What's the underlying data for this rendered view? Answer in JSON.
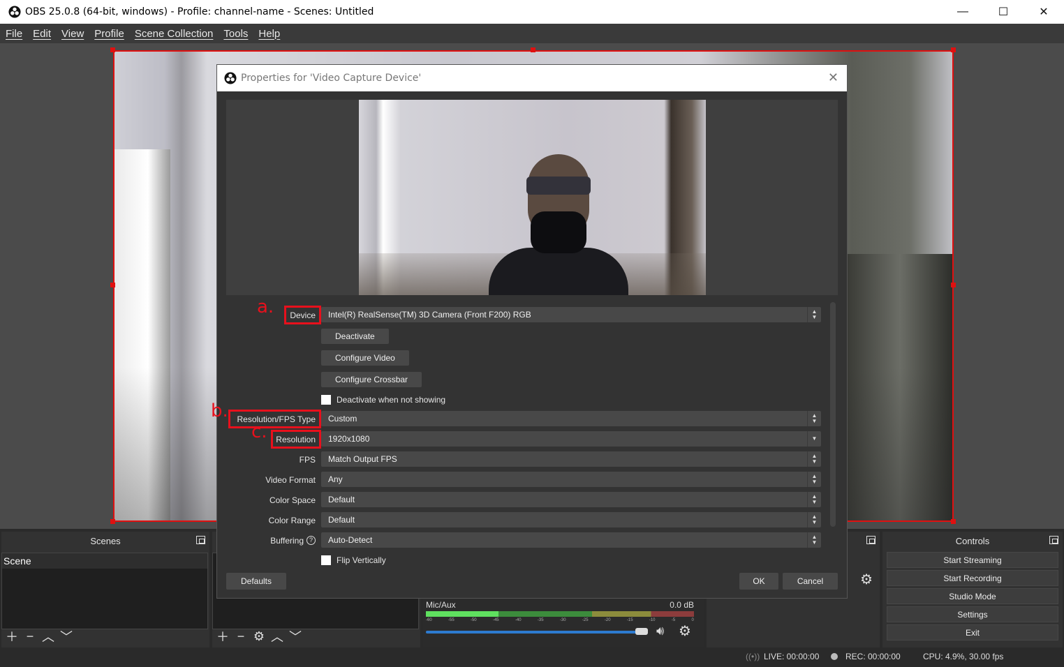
{
  "window": {
    "title": "OBS 25.0.8 (64-bit, windows) - Profile: channel-name - Scenes: Untitled",
    "minimize": "—",
    "maximize": "☐",
    "close": "✕"
  },
  "menu": [
    "File",
    "Edit",
    "View",
    "Profile",
    "Scene Collection",
    "Tools",
    "Help"
  ],
  "dialog": {
    "title": "Properties for 'Video Capture Device'",
    "close": "✕",
    "annotations": {
      "a": "a.",
      "b": "b.",
      "c": "c."
    },
    "fields": {
      "device": {
        "label": "Device",
        "value": "Intel(R) RealSense(TM) 3D Camera (Front F200) RGB"
      },
      "deactivate": "Deactivate",
      "configure_video": "Configure Video",
      "configure_crossbar": "Configure Crossbar",
      "deactivate_when_not_showing": "Deactivate when not showing",
      "res_fps_type": {
        "label": "Resolution/FPS Type",
        "value": "Custom"
      },
      "resolution": {
        "label": "Resolution",
        "value": "1920x1080"
      },
      "fps": {
        "label": "FPS",
        "value": "Match Output FPS"
      },
      "video_format": {
        "label": "Video Format",
        "value": "Any"
      },
      "color_space": {
        "label": "Color Space",
        "value": "Default"
      },
      "color_range": {
        "label": "Color Range",
        "value": "Default"
      },
      "buffering": {
        "label": "Buffering",
        "value": "Auto-Detect",
        "help": "?"
      },
      "flip_vertically": "Flip Vertically"
    },
    "buttons": {
      "defaults": "Defaults",
      "ok": "OK",
      "cancel": "Cancel"
    }
  },
  "docks": {
    "scenes": {
      "title": "Scenes",
      "items": [
        "Scene"
      ]
    },
    "controls": {
      "title": "Controls",
      "buttons": [
        "Start Streaming",
        "Start Recording",
        "Studio Mode",
        "Settings",
        "Exit"
      ]
    },
    "mixer": {
      "source": "Mic/Aux",
      "db": "0.0 dB",
      "scale": [
        "-60",
        "-55",
        "-50",
        "-45",
        "-40",
        "-35",
        "-30",
        "-25",
        "-20",
        "-15",
        "-10",
        "-5",
        "0"
      ],
      "level_fraction": 0.27,
      "volume_fraction": 0.98
    }
  },
  "status": {
    "live": "LIVE: 00:00:00",
    "rec": "REC: 00:00:00",
    "cpu": "CPU: 4.9%, 30.00 fps"
  },
  "colors": {
    "highlight": "#e8101c",
    "accent": "#2d7bd0"
  }
}
